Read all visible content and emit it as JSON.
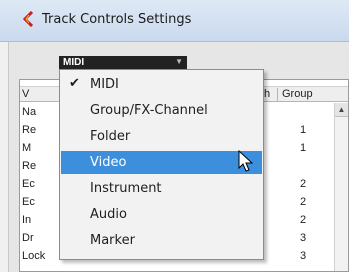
{
  "window": {
    "title": "Track Controls Settings"
  },
  "type_select": {
    "value": "MIDI"
  },
  "table": {
    "headers": {
      "name": "V",
      "width": "h",
      "group": "Group"
    },
    "rows": [
      {
        "name": "Na",
        "group": ""
      },
      {
        "name": "Re",
        "group": "1"
      },
      {
        "name": "M",
        "group": "1"
      },
      {
        "name": "Re",
        "group": ""
      },
      {
        "name": "Ec",
        "group": "2"
      },
      {
        "name": "Ec",
        "group": "2"
      },
      {
        "name": "In",
        "group": "2"
      },
      {
        "name": "Dr",
        "group": "3"
      },
      {
        "name": "Lock",
        "group": "3"
      }
    ]
  },
  "menu": {
    "items": [
      {
        "label": "MIDI",
        "checked": true
      },
      {
        "label": "Group/FX-Channel",
        "checked": false
      },
      {
        "label": "Folder",
        "checked": false
      },
      {
        "label": "Video",
        "checked": false,
        "highlighted": true
      },
      {
        "label": "Instrument",
        "checked": false
      },
      {
        "label": "Audio",
        "checked": false
      },
      {
        "label": "Marker",
        "checked": false
      }
    ],
    "check_glyph": "✔",
    "highlight_color": "#3c8fdc"
  },
  "icons": {
    "title_icon": "cubase-logo-icon",
    "pointer": "mouse-pointer-icon"
  }
}
